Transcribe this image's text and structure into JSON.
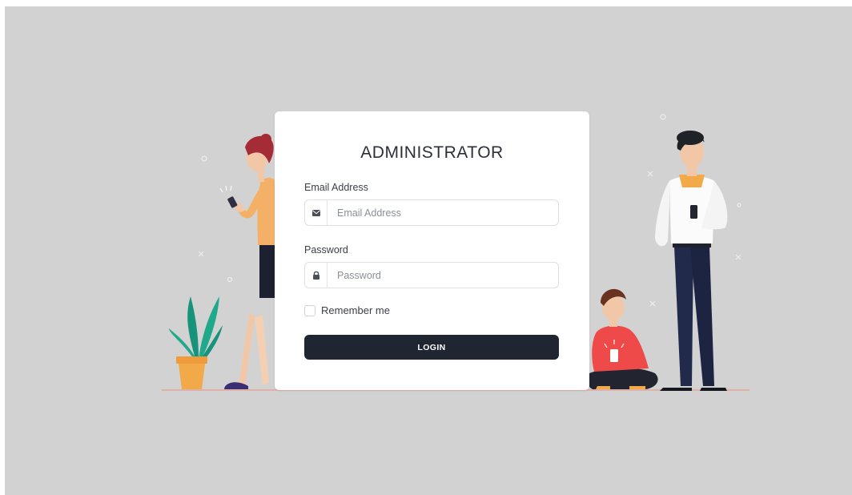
{
  "login": {
    "title": "ADMINISTRATOR",
    "email_label": "Email Address",
    "email_placeholder": "Email Address",
    "password_label": "Password",
    "password_placeholder": "Password",
    "remember_label": "Remember me",
    "remember_checked": false,
    "login_label": "LOGIN"
  },
  "icons": {
    "email": "envelope-icon",
    "password": "lock-icon"
  },
  "colors": {
    "background": "#d2d2d2",
    "card": "#ffffff",
    "button": "#1f2632",
    "button_text": "#ffffff"
  }
}
